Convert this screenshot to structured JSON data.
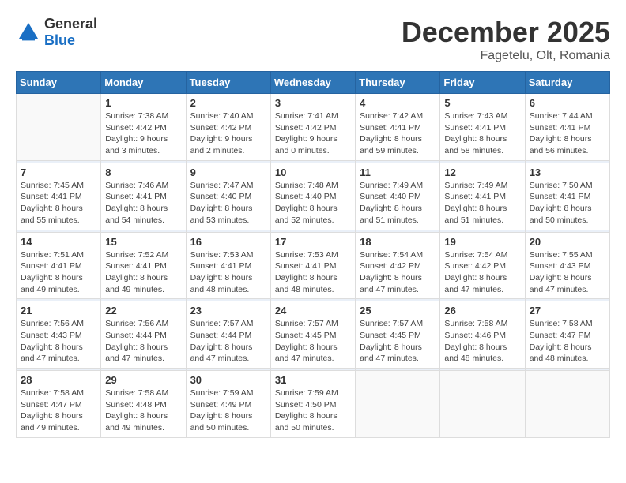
{
  "header": {
    "logo_general": "General",
    "logo_blue": "Blue",
    "month": "December 2025",
    "location": "Fagetelu, Olt, Romania"
  },
  "days_of_week": [
    "Sunday",
    "Monday",
    "Tuesday",
    "Wednesday",
    "Thursday",
    "Friday",
    "Saturday"
  ],
  "weeks": [
    [
      {
        "day": "",
        "sunrise": "",
        "sunset": "",
        "daylight": "",
        "empty": true
      },
      {
        "day": "1",
        "sunrise": "Sunrise: 7:38 AM",
        "sunset": "Sunset: 4:42 PM",
        "daylight": "Daylight: 9 hours and 3 minutes."
      },
      {
        "day": "2",
        "sunrise": "Sunrise: 7:40 AM",
        "sunset": "Sunset: 4:42 PM",
        "daylight": "Daylight: 9 hours and 2 minutes."
      },
      {
        "day": "3",
        "sunrise": "Sunrise: 7:41 AM",
        "sunset": "Sunset: 4:42 PM",
        "daylight": "Daylight: 9 hours and 0 minutes."
      },
      {
        "day": "4",
        "sunrise": "Sunrise: 7:42 AM",
        "sunset": "Sunset: 4:41 PM",
        "daylight": "Daylight: 8 hours and 59 minutes."
      },
      {
        "day": "5",
        "sunrise": "Sunrise: 7:43 AM",
        "sunset": "Sunset: 4:41 PM",
        "daylight": "Daylight: 8 hours and 58 minutes."
      },
      {
        "day": "6",
        "sunrise": "Sunrise: 7:44 AM",
        "sunset": "Sunset: 4:41 PM",
        "daylight": "Daylight: 8 hours and 56 minutes."
      }
    ],
    [
      {
        "day": "7",
        "sunrise": "Sunrise: 7:45 AM",
        "sunset": "Sunset: 4:41 PM",
        "daylight": "Daylight: 8 hours and 55 minutes."
      },
      {
        "day": "8",
        "sunrise": "Sunrise: 7:46 AM",
        "sunset": "Sunset: 4:41 PM",
        "daylight": "Daylight: 8 hours and 54 minutes."
      },
      {
        "day": "9",
        "sunrise": "Sunrise: 7:47 AM",
        "sunset": "Sunset: 4:40 PM",
        "daylight": "Daylight: 8 hours and 53 minutes."
      },
      {
        "day": "10",
        "sunrise": "Sunrise: 7:48 AM",
        "sunset": "Sunset: 4:40 PM",
        "daylight": "Daylight: 8 hours and 52 minutes."
      },
      {
        "day": "11",
        "sunrise": "Sunrise: 7:49 AM",
        "sunset": "Sunset: 4:40 PM",
        "daylight": "Daylight: 8 hours and 51 minutes."
      },
      {
        "day": "12",
        "sunrise": "Sunrise: 7:49 AM",
        "sunset": "Sunset: 4:41 PM",
        "daylight": "Daylight: 8 hours and 51 minutes."
      },
      {
        "day": "13",
        "sunrise": "Sunrise: 7:50 AM",
        "sunset": "Sunset: 4:41 PM",
        "daylight": "Daylight: 8 hours and 50 minutes."
      }
    ],
    [
      {
        "day": "14",
        "sunrise": "Sunrise: 7:51 AM",
        "sunset": "Sunset: 4:41 PM",
        "daylight": "Daylight: 8 hours and 49 minutes."
      },
      {
        "day": "15",
        "sunrise": "Sunrise: 7:52 AM",
        "sunset": "Sunset: 4:41 PM",
        "daylight": "Daylight: 8 hours and 49 minutes."
      },
      {
        "day": "16",
        "sunrise": "Sunrise: 7:53 AM",
        "sunset": "Sunset: 4:41 PM",
        "daylight": "Daylight: 8 hours and 48 minutes."
      },
      {
        "day": "17",
        "sunrise": "Sunrise: 7:53 AM",
        "sunset": "Sunset: 4:41 PM",
        "daylight": "Daylight: 8 hours and 48 minutes."
      },
      {
        "day": "18",
        "sunrise": "Sunrise: 7:54 AM",
        "sunset": "Sunset: 4:42 PM",
        "daylight": "Daylight: 8 hours and 47 minutes."
      },
      {
        "day": "19",
        "sunrise": "Sunrise: 7:54 AM",
        "sunset": "Sunset: 4:42 PM",
        "daylight": "Daylight: 8 hours and 47 minutes."
      },
      {
        "day": "20",
        "sunrise": "Sunrise: 7:55 AM",
        "sunset": "Sunset: 4:43 PM",
        "daylight": "Daylight: 8 hours and 47 minutes."
      }
    ],
    [
      {
        "day": "21",
        "sunrise": "Sunrise: 7:56 AM",
        "sunset": "Sunset: 4:43 PM",
        "daylight": "Daylight: 8 hours and 47 minutes."
      },
      {
        "day": "22",
        "sunrise": "Sunrise: 7:56 AM",
        "sunset": "Sunset: 4:44 PM",
        "daylight": "Daylight: 8 hours and 47 minutes."
      },
      {
        "day": "23",
        "sunrise": "Sunrise: 7:57 AM",
        "sunset": "Sunset: 4:44 PM",
        "daylight": "Daylight: 8 hours and 47 minutes."
      },
      {
        "day": "24",
        "sunrise": "Sunrise: 7:57 AM",
        "sunset": "Sunset: 4:45 PM",
        "daylight": "Daylight: 8 hours and 47 minutes."
      },
      {
        "day": "25",
        "sunrise": "Sunrise: 7:57 AM",
        "sunset": "Sunset: 4:45 PM",
        "daylight": "Daylight: 8 hours and 47 minutes."
      },
      {
        "day": "26",
        "sunrise": "Sunrise: 7:58 AM",
        "sunset": "Sunset: 4:46 PM",
        "daylight": "Daylight: 8 hours and 48 minutes."
      },
      {
        "day": "27",
        "sunrise": "Sunrise: 7:58 AM",
        "sunset": "Sunset: 4:47 PM",
        "daylight": "Daylight: 8 hours and 48 minutes."
      }
    ],
    [
      {
        "day": "28",
        "sunrise": "Sunrise: 7:58 AM",
        "sunset": "Sunset: 4:47 PM",
        "daylight": "Daylight: 8 hours and 49 minutes."
      },
      {
        "day": "29",
        "sunrise": "Sunrise: 7:58 AM",
        "sunset": "Sunset: 4:48 PM",
        "daylight": "Daylight: 8 hours and 49 minutes."
      },
      {
        "day": "30",
        "sunrise": "Sunrise: 7:59 AM",
        "sunset": "Sunset: 4:49 PM",
        "daylight": "Daylight: 8 hours and 50 minutes."
      },
      {
        "day": "31",
        "sunrise": "Sunrise: 7:59 AM",
        "sunset": "Sunset: 4:50 PM",
        "daylight": "Daylight: 8 hours and 50 minutes."
      },
      {
        "day": "",
        "sunrise": "",
        "sunset": "",
        "daylight": "",
        "empty": true
      },
      {
        "day": "",
        "sunrise": "",
        "sunset": "",
        "daylight": "",
        "empty": true
      },
      {
        "day": "",
        "sunrise": "",
        "sunset": "",
        "daylight": "",
        "empty": true
      }
    ]
  ]
}
